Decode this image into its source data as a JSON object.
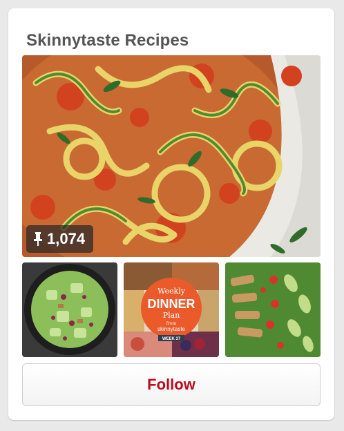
{
  "board": {
    "title": "Skinnytaste Recipes",
    "pin_count": "1,074",
    "follow_label": "Follow"
  },
  "thumbnails": [
    {
      "name": "salad-thumb"
    },
    {
      "name": "dinner-plan-thumb",
      "badge_top": "Weekly",
      "badge_main": "DINNER",
      "badge_sub": "Plan",
      "badge_from": "from",
      "badge_brand": "skinnytaste",
      "badge_week": "WEEK 37"
    },
    {
      "name": "chicken-salad-thumb"
    }
  ],
  "colors": {
    "title": "#555555",
    "follow_text": "#bd0a1c",
    "badge_orange": "#ea5a2b"
  }
}
